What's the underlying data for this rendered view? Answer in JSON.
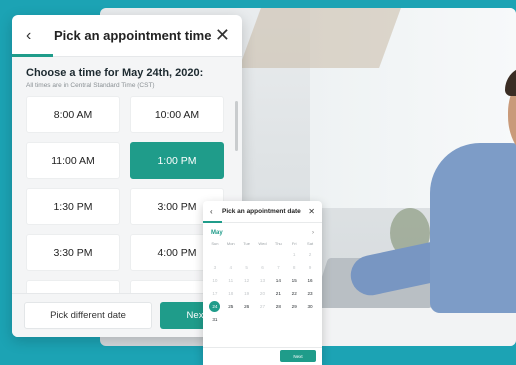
{
  "colors": {
    "accent": "#1f9c8a",
    "background": "#1ca3b4"
  },
  "main": {
    "header": {
      "title": "Pick an appointment time",
      "back_icon": "chevron-left-icon",
      "close_icon": "close-icon",
      "progress": 0.18
    },
    "heading": "Choose a time for May 24th, 2020:",
    "timezone": "All times are in Central Standard Time (CST)",
    "slots": [
      {
        "label": "8:00 AM",
        "selected": false
      },
      {
        "label": "10:00 AM",
        "selected": false
      },
      {
        "label": "11:00 AM",
        "selected": false
      },
      {
        "label": "1:00 PM",
        "selected": true
      },
      {
        "label": "1:30 PM",
        "selected": false
      },
      {
        "label": "3:00 PM",
        "selected": false
      },
      {
        "label": "3:30 PM",
        "selected": false
      },
      {
        "label": "4:00 PM",
        "selected": false
      },
      {
        "label": "",
        "selected": false
      },
      {
        "label": "",
        "selected": false
      }
    ],
    "footer": {
      "secondary": "Pick different date",
      "primary": "Nex"
    }
  },
  "calendar": {
    "header": {
      "title": "Pick an appointment date",
      "back_icon": "chevron-left-icon",
      "close_icon": "close-icon",
      "progress": 0.16
    },
    "month": "May",
    "next_icon": "chevron-right-icon",
    "weekdays": [
      "Sun",
      "Mon",
      "Tue",
      "Wed",
      "Thu",
      "Fri",
      "Sat"
    ],
    "weeks": [
      [
        "",
        "",
        "",
        "",
        "",
        "1",
        "2"
      ],
      [
        "3",
        "4",
        "5",
        "6",
        "7",
        "8",
        "9"
      ],
      [
        "10",
        "11",
        "12",
        "13",
        "14",
        "15",
        "16"
      ],
      [
        "17",
        "18",
        "19",
        "20",
        "21",
        "22",
        "23"
      ],
      [
        "24",
        "25",
        "26",
        "27",
        "28",
        "29",
        "30"
      ],
      [
        "31",
        "",
        "",
        "",
        "",
        "",
        ""
      ]
    ],
    "available_days": [
      "14",
      "15",
      "16",
      "21",
      "22",
      "23",
      "24",
      "25",
      "26",
      "28",
      "29",
      "30",
      "31"
    ],
    "selected_day": "24",
    "next_label": "Next"
  }
}
